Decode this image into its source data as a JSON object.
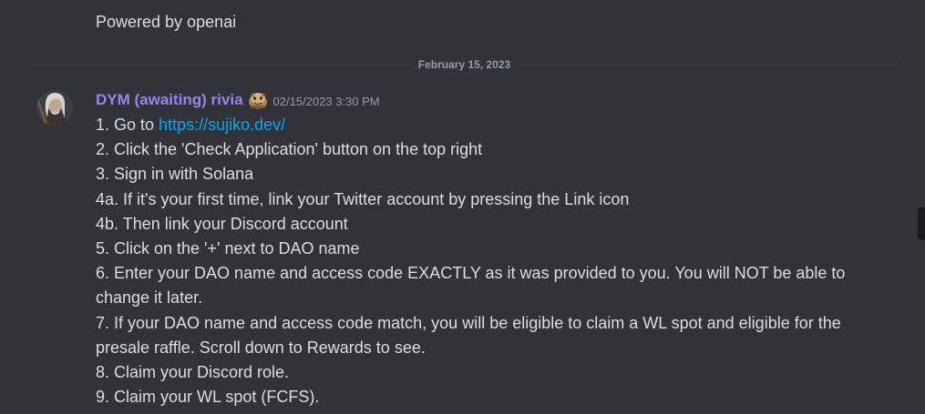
{
  "previous_message": {
    "text": "Powered by openai"
  },
  "divider": {
    "date": "February 15, 2023"
  },
  "message": {
    "username": "DYM (awaiting) rivia",
    "role_icon": "custom-emoji-icon",
    "timestamp": "02/15/2023 3:30 PM",
    "lines": [
      {
        "prefix": "1. Go to ",
        "link": "https://sujiko.dev/"
      },
      {
        "text": "2. Click the 'Check Application' button on the top right"
      },
      {
        "text": "3. Sign in with Solana"
      },
      {
        "text": "4a. If it's your first time, link your Twitter account by pressing the Link icon"
      },
      {
        "text": "4b. Then link your Discord account"
      },
      {
        "text": "5. Click on the '+' next to DAO name"
      },
      {
        "text": "6. Enter your DAO name and access code EXACTLY as it was provided to you. You will NOT be able to change it later."
      },
      {
        "text": "7. If your DAO name and access code match, you will be eligible to claim a WL spot and eligible for the presale raffle. Scroll down to Rewards to see."
      },
      {
        "text": "8. Claim your Discord role."
      },
      {
        "text": "9. Claim your WL spot (FCFS)."
      }
    ]
  },
  "colors": {
    "background": "#313338",
    "username": "#9b84ec",
    "link": "#00a8fc",
    "muted": "#949ba4",
    "text": "#dbdee1"
  }
}
